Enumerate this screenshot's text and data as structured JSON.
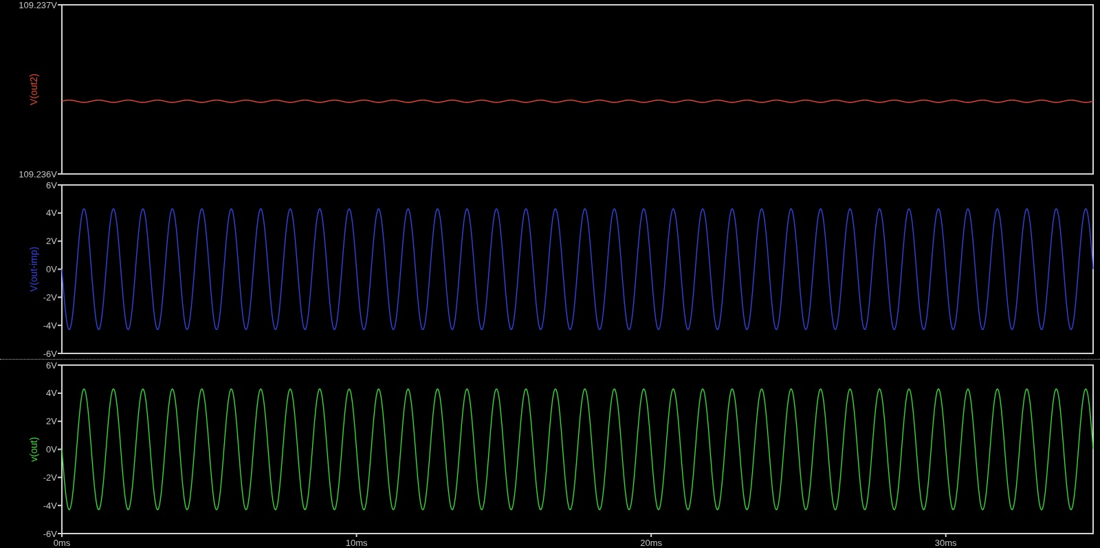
{
  "panes": [
    {
      "kind": "ripple",
      "trace": "V(out2)",
      "color": "#e5472f",
      "ticks": [
        "109.237V",
        "109.236V"
      ]
    },
    {
      "kind": "sine",
      "trace": "V(out-imp)",
      "color": "#3344e0",
      "ticks": [
        "6V",
        "4V",
        "2V",
        "0V",
        "-2V",
        "-4V",
        "-6V"
      ]
    },
    {
      "kind": "sine",
      "trace": "v(out)",
      "color": "#33dd33",
      "ticks": [
        "6V",
        "4V",
        "2V",
        "0V",
        "-2V",
        "-4V",
        "-6V"
      ]
    }
  ],
  "x_ticks": [
    "0ms",
    "10ms",
    "20ms",
    "30ms"
  ]
}
